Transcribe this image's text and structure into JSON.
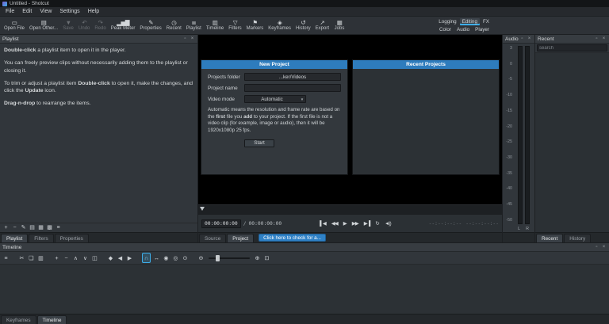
{
  "window": {
    "title": "Untitled - Shotcut"
  },
  "menu": {
    "items": [
      "File",
      "Edit",
      "View",
      "Settings",
      "Help"
    ]
  },
  "toolbar": {
    "buttons": [
      {
        "name": "open-file",
        "glyph": "▭",
        "label": "Open File"
      },
      {
        "name": "open-other",
        "glyph": "▤",
        "label": "Open Other..."
      },
      {
        "name": "save",
        "glyph": "▼",
        "label": "Save"
      },
      {
        "name": "undo",
        "glyph": "↶",
        "label": "Undo"
      },
      {
        "name": "redo",
        "glyph": "↷",
        "label": "Redo"
      },
      {
        "name": "peak-meter",
        "glyph": "▂▅▇",
        "label": "Peak Meter"
      },
      {
        "name": "properties",
        "glyph": "✎",
        "label": "Properties"
      },
      {
        "name": "recent",
        "glyph": "◷",
        "label": "Recent"
      },
      {
        "name": "playlist",
        "glyph": "≣",
        "label": "Playlist"
      },
      {
        "name": "timeline",
        "glyph": "▥",
        "label": "Timeline"
      },
      {
        "name": "filters",
        "glyph": "▽",
        "label": "Filters"
      },
      {
        "name": "markers",
        "glyph": "⚑",
        "label": "Markers"
      },
      {
        "name": "keyframes",
        "glyph": "◈",
        "label": "Keyframes"
      },
      {
        "name": "history",
        "glyph": "↺",
        "label": "History"
      },
      {
        "name": "export",
        "glyph": "↗",
        "label": "Export"
      },
      {
        "name": "jobs",
        "glyph": "▦",
        "label": "Jobs"
      }
    ],
    "layouts_row1": [
      "Logging",
      "Editing",
      "FX"
    ],
    "layouts_row2": [
      "Color",
      "Audio",
      "Player"
    ],
    "active_layout": "Editing"
  },
  "dock": {
    "float_glyph": "▫",
    "close_glyph": "×"
  },
  "playlist": {
    "title": "Playlist",
    "tip1_bold": "Double-click",
    "tip1_rest": " a playlist item to open it in the player.",
    "tip2": "You can freely preview clips without necessarily adding them to the playlist or closing it.",
    "tip3_pre": "To trim or adjust a playlist item ",
    "tip3_bold1": "Double-click",
    "tip3_mid": " to open it, make the changes, and click the ",
    "tip3_bold2": "Update",
    "tip3_post": " icon.",
    "tip4_bold": "Drag-n-drop",
    "tip4_rest": " to rearrange the items.",
    "tools": [
      {
        "name": "add",
        "glyph": "+"
      },
      {
        "name": "remove",
        "glyph": "−"
      },
      {
        "name": "update",
        "glyph": "✎"
      },
      {
        "name": "view-details",
        "glyph": "▤"
      },
      {
        "name": "view-tiles",
        "glyph": "▦"
      },
      {
        "name": "view-icons",
        "glyph": "▩"
      },
      {
        "name": "menu",
        "glyph": "≡"
      }
    ],
    "tabs": [
      "Playlist",
      "Filters",
      "Properties"
    ]
  },
  "project": {
    "new_title": "New Project",
    "recent_title": "Recent Projects",
    "folder_label": "Projects folder",
    "folder_value": "...ker/Videos",
    "name_label": "Project name",
    "name_value": "",
    "mode_label": "Video mode",
    "mode_value": "Automatic",
    "note_p1": "Automatic means the resolution and frame rate are based on the ",
    "note_b1": "first",
    "note_p2": " file you ",
    "note_b2": "add",
    "note_p3": " to your project. If the first file is not a video clip (for example, image or audio), then it will be 1920x1080p 25 fps.",
    "start_label": "Start"
  },
  "player": {
    "position": "00:00:00:00",
    "separator": "/",
    "duration": "00:00:00:00",
    "transport": [
      {
        "name": "skip-to-start",
        "glyph": "▌◀"
      },
      {
        "name": "play-backwards",
        "glyph": "◀◀"
      },
      {
        "name": "play",
        "glyph": "▶"
      },
      {
        "name": "play-forwards",
        "glyph": "▶▶"
      },
      {
        "name": "skip-to-end",
        "glyph": "▶▐"
      }
    ],
    "loop_glyph": "↻",
    "volume_glyph": "◄))",
    "in_point": "--:--:--:--",
    "selected_duration": "--:--:--:--",
    "tabs": [
      "Source",
      "Project"
    ],
    "update_button": "Click here to check for a..."
  },
  "audio_meter": {
    "title": "Audio",
    "scale": [
      "3",
      "0",
      "-5",
      "-10",
      "-15",
      "-20",
      "-25",
      "-30",
      "-35",
      "-40",
      "-45",
      "-50"
    ],
    "channels": [
      "L",
      "R"
    ]
  },
  "recent_panel": {
    "title": "Recent",
    "search_placeholder": "search",
    "tabs": [
      "Recent",
      "History"
    ]
  },
  "timeline": {
    "title": "Timeline",
    "tools": [
      {
        "name": "timeline-menu",
        "glyph": "≡"
      },
      {
        "name": "cut",
        "glyph": "✂"
      },
      {
        "name": "copy",
        "glyph": "❏"
      },
      {
        "name": "paste",
        "glyph": "▥"
      },
      {
        "name": "append",
        "glyph": "+"
      },
      {
        "name": "ripple-delete",
        "glyph": "−"
      },
      {
        "name": "lift",
        "glyph": "∧"
      },
      {
        "name": "overwrite",
        "glyph": "∨"
      },
      {
        "name": "split",
        "glyph": "◫"
      },
      {
        "name": "marker",
        "glyph": "◆"
      },
      {
        "name": "prev-marker",
        "glyph": "◀"
      },
      {
        "name": "next-marker",
        "glyph": "▶"
      },
      {
        "name": "snap",
        "glyph": "∩"
      },
      {
        "name": "scrub",
        "glyph": "↔"
      },
      {
        "name": "ripple",
        "glyph": "◉"
      },
      {
        "name": "ripple-all-tracks",
        "glyph": "◎"
      },
      {
        "name": "ripple-markers",
        "glyph": "⊙"
      },
      {
        "name": "zoom-out",
        "glyph": "⊖"
      },
      {
        "name": "zoom-in",
        "glyph": "⊕"
      },
      {
        "name": "zoom-fit",
        "glyph": "⊡"
      }
    ]
  },
  "bottom_tabs": [
    "Keyframes",
    "Timeline"
  ]
}
